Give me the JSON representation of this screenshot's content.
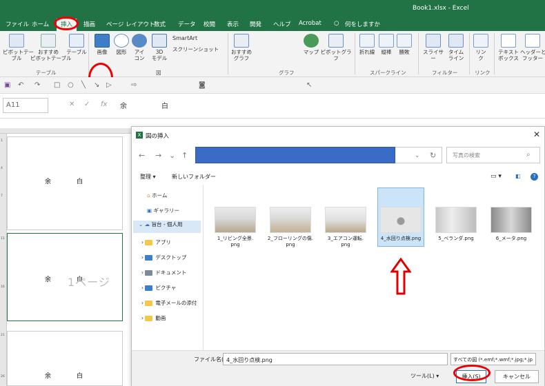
{
  "window": {
    "title": "Book1.xlsx  -  Excel"
  },
  "tabs": [
    "ファイル",
    "ホーム",
    "挿入",
    "描画",
    "ページ レイアウト",
    "数式",
    "データ",
    "校閲",
    "表示",
    "開発",
    "ヘルプ",
    "Acrobat",
    "何をしますか"
  ],
  "ribbon": {
    "items": [
      {
        "label": "ピボットテー\nブル"
      },
      {
        "label": "おすすめ\nピボットテーブル"
      },
      {
        "label": "テーブル"
      },
      {
        "label": "画像"
      },
      {
        "label": "図形"
      },
      {
        "label": "アイ\nコン"
      },
      {
        "label": "3D\nモデル"
      },
      {
        "label": "SmartArt"
      },
      {
        "label": "スクリーンショット"
      },
      {
        "label": "おすすめ\nグラフ"
      },
      {
        "label": "マップ"
      },
      {
        "label": "ピボットグラフ"
      },
      {
        "label": "折れ線"
      },
      {
        "label": "縦棒"
      },
      {
        "label": "勝敗"
      },
      {
        "label": "スライサー"
      },
      {
        "label": "タイム\nライン"
      },
      {
        "label": "リン\nク"
      },
      {
        "label": "テキスト\nボックス"
      },
      {
        "label": "ヘッダーと\nフッター"
      }
    ],
    "groups": [
      "テーブル",
      "図",
      "グラフ",
      "スパークライン",
      "フィルター",
      "リンク"
    ]
  },
  "formula_bar": {
    "name_box": "A11",
    "content": "余　白"
  },
  "sheet": {
    "cell_text": "余　白",
    "page_watermark": "1ページ"
  },
  "dialog": {
    "title": "図の挿入",
    "search_placeholder": "写真の検索",
    "organize": "整理 ▾",
    "new_folder": "新しいフォルダー",
    "nav": [
      "ホーム",
      "ギャラリー",
      "旨台 - 個人用",
      "アプリ",
      "デスクトップ",
      "ドキュメント",
      "ピクチャ",
      "電子メールの添付",
      "動画"
    ],
    "files": [
      {
        "name": "1_リビング全景.\npng",
        "selected": false
      },
      {
        "name": "2_フローリングの傷.\npng",
        "selected": false
      },
      {
        "name": "3_エアコン運転.\npng",
        "selected": false
      },
      {
        "name": "4_水回り点検.png",
        "selected": true
      },
      {
        "name": "5_ベランダ.png",
        "selected": false
      },
      {
        "name": "6_メータ.png",
        "selected": false
      }
    ],
    "filename_label": "ファイル名(N):",
    "filename_value": "4_水回り点検.png",
    "filetype": "すべての図 (*.emf;*.wmf;*.jpg;*.jp",
    "tools": "ツール(L)  ▾",
    "insert": "挿入(S)",
    "cancel": "キャンセル"
  },
  "colors": {
    "excel_green": "#217346",
    "highlight_red": "#e00000",
    "selection_blue": "#cce4f7"
  }
}
